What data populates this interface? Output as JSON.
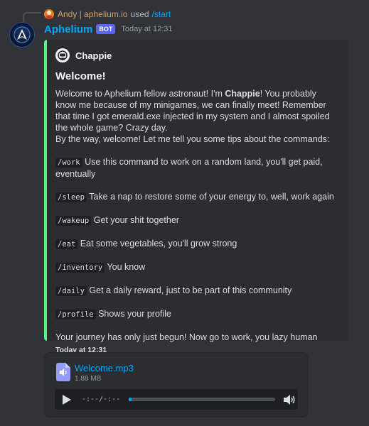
{
  "reply": {
    "username": "Andy | aphelium.io",
    "used_text": "used",
    "command": "/start"
  },
  "message": {
    "bot_name": "Aphelium",
    "bot_tag": "BOT",
    "timestamp": "Today at 12:31"
  },
  "embed": {
    "accent_color": "#57f287",
    "author": "Chappie",
    "title": "Welcome!",
    "intro_part1": "Welcome to Aphelium fellow astronaut! I'm ",
    "intro_bold": "Chappie",
    "intro_part2": "! You probably know me because of my minigames, we can finally meet! Remember that time I got emerald.exe injected in my system and I almost spoiled the whole game? Crazy day.",
    "intro_line2": "By the way, welcome! Let me tell you some tips about the commands:",
    "commands": [
      {
        "cmd": "/work",
        "desc": "Use this command to work on a random land, you'll get paid, eventually"
      },
      {
        "cmd": "/sleep",
        "desc": "Take a nap to restore some of your energy to, well, work again"
      },
      {
        "cmd": "/wakeup",
        "desc": "Get your shit together"
      },
      {
        "cmd": "/eat",
        "desc": "Eat some vegetables, you'll grow strong"
      },
      {
        "cmd": "/inventory",
        "desc": "You know"
      },
      {
        "cmd": "/daily",
        "desc": "Get a daily reward, just to be part of this community"
      },
      {
        "cmd": "/profile",
        "desc": "Shows your profile"
      }
    ],
    "closing": "Your journey has only just begun! Now go to work, you lazy human",
    "footer": "Today at 12:31"
  },
  "attachment": {
    "file_name": "Welcome.mp3",
    "file_size": "1.88 MB",
    "time": "-:--/-:--",
    "progress": 0.02
  }
}
